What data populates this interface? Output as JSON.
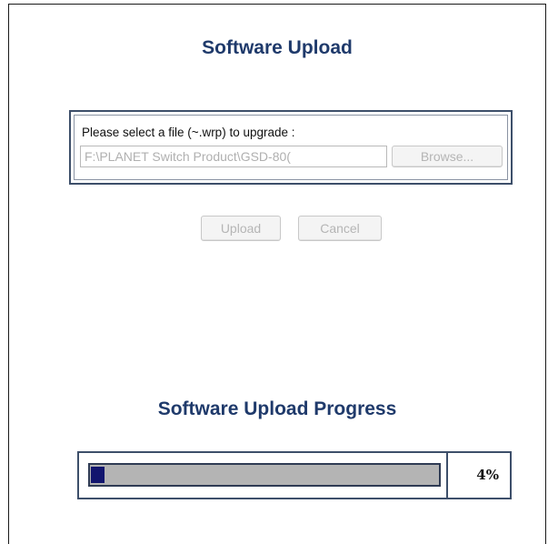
{
  "upload": {
    "title": "Software Upload",
    "file_label": "Please select a file (~.wrp) to upgrade :",
    "file_path": "F:\\PLANET Switch Product\\GSD-80(",
    "browse_label": "Browse...",
    "upload_label": "Upload",
    "cancel_label": "Cancel"
  },
  "progress": {
    "title": "Software Upload Progress",
    "percent": 4,
    "percent_text": "4%",
    "fill_color": "#12156e",
    "track_color": "#b4b4b4"
  },
  "colors": {
    "title": "#1f3a6b",
    "border": "#3d4f6a"
  }
}
